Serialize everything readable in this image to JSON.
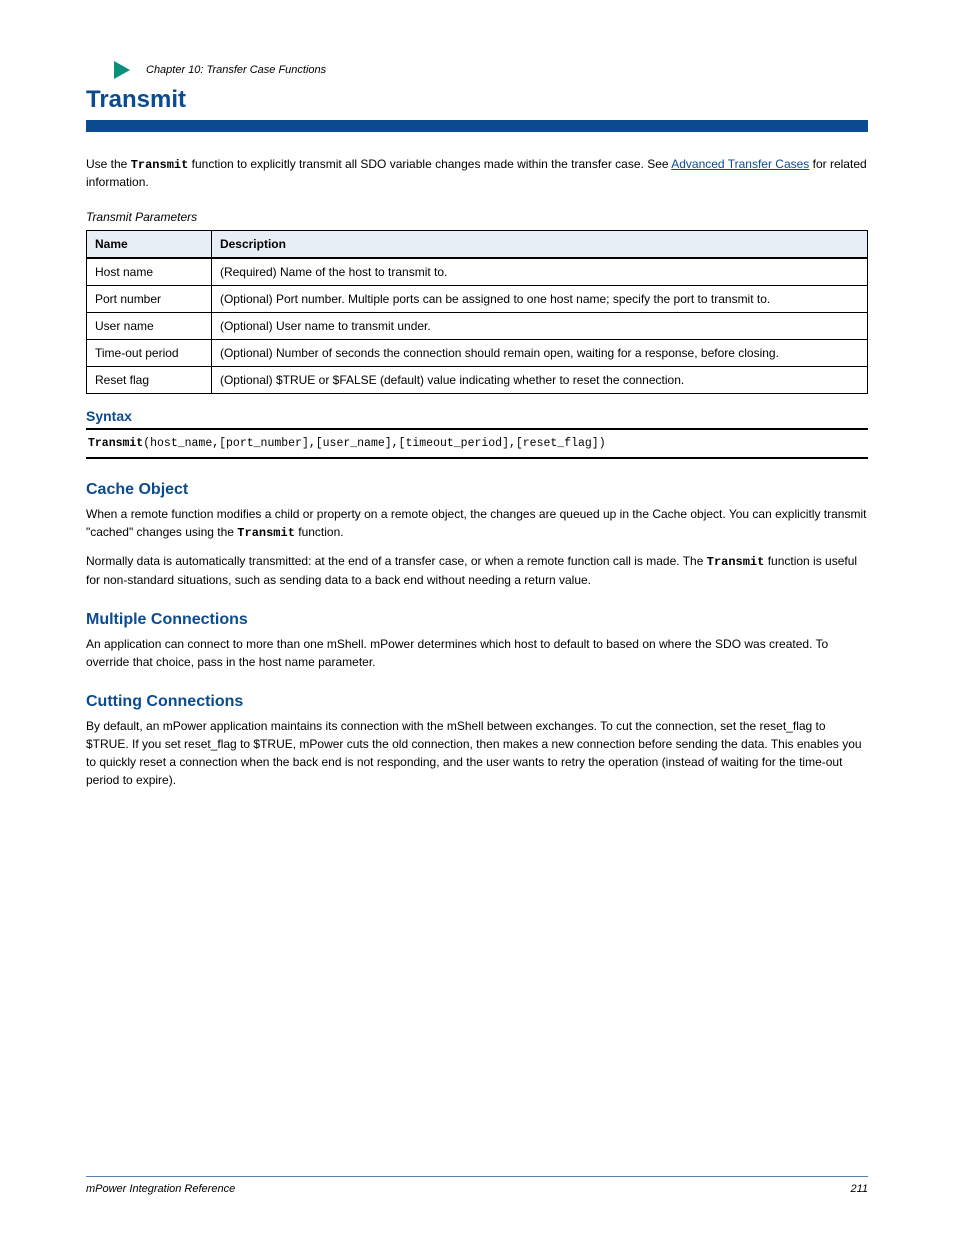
{
  "header": {
    "chapter_label": "Chapter 10: Transfer Case Functions",
    "page_title": "Transmit"
  },
  "blue_bar_color": "#0b4b8f",
  "intro_html": "Use the <span class=\"kw\" style=\"font-family:Courier New,monospace\">Transmit</span> function to explicitly transmit all SDO variable changes made within the transfer case. See <a style=\"color:#0b4b8f;text-decoration:underline\">Advanced Transfer Cases</a> for related information.",
  "table": {
    "caption": "Transmit Parameters",
    "headers": [
      "Name",
      "Description"
    ],
    "rows": [
      [
        "Host name",
        "(Required) Name of the host to transmit to."
      ],
      [
        "Port number",
        "(Optional) Port number. Multiple ports can be assigned to one host name; specify the port to transmit to."
      ],
      [
        "User name",
        "(Optional) User name to transmit under."
      ],
      [
        "Time-out period",
        "(Optional) Number of seconds the connection should remain open, waiting for a response, before closing."
      ],
      [
        "Reset flag",
        "(Optional) $TRUE or $FALSE (default) value indicating whether to reset the connection."
      ]
    ]
  },
  "syntax": {
    "label": "Syntax",
    "code_html": "<span class=\"kw\">Transmit</span>(host_name,[port_number],[user_name],[timeout_period],[reset_flag])"
  },
  "sections": [
    {
      "title": "Cache Object",
      "paragraphs": [
        "When a remote function modifies a child or property on a remote object, the changes are queued up in the Cache object. You can explicitly transmit \"cached\" changes using the <span class=\"kw\" style=\"font-family:Courier New,monospace\">Transmit</span> function.",
        "Normally data is automatically transmitted: at the end of a transfer case, or when a remote function call is made. The <span class=\"kw\" style=\"font-family:Courier New,monospace\">Transmit</span> function is useful for non-standard situations, such as sending data to a back end without needing a return value."
      ]
    },
    {
      "title": "Multiple Connections",
      "paragraphs": [
        "An application can connect to more than one mShell. mPower determines which host to default to based on where the SDO was created. To override that choice, pass in the host name parameter."
      ]
    },
    {
      "title": "Cutting Connections",
      "paragraphs": [
        "By default, an mPower application maintains its connection with the mShell between exchanges. To cut the connection, set the reset_flag to $TRUE. If you set reset_flag to $TRUE, mPower cuts the old connection, then makes a new connection before sending the data. This enables you to quickly reset a connection when the back end is not responding, and the user wants to retry the operation (instead of waiting for the time-out period to expire)."
      ]
    }
  ],
  "footer": {
    "left": "mPower Integration Reference",
    "right": "211"
  }
}
